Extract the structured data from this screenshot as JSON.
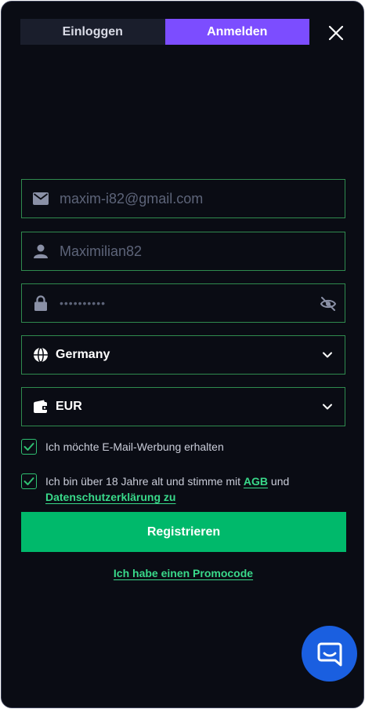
{
  "tabs": [
    {
      "label": "Einloggen",
      "active": false
    },
    {
      "label": "Anmelden",
      "active": true
    }
  ],
  "form": {
    "email": {
      "value": "maxim-i82@gmail.com",
      "icon": "mail-icon"
    },
    "username": {
      "value": "Maximilian82",
      "icon": "user-icon"
    },
    "password": {
      "value": "••••••••••",
      "icon": "lock-icon",
      "toggle_icon": "eye-off-icon"
    },
    "country": {
      "value": "Germany",
      "icon": "globe-icon"
    },
    "currency": {
      "value": "EUR",
      "icon": "wallet-icon"
    }
  },
  "consent": {
    "email_marketing": {
      "checked": true,
      "text": "Ich möchte E-Mail-Werbung erhalten"
    },
    "age_terms": {
      "checked": true,
      "text_before": "Ich bin über 18 Jahre alt und stimme mit ",
      "agb_link": "AGB",
      "text_middle": " und",
      "privacy_link": "Datenschutzerklärung zu"
    }
  },
  "register_button": "Registrieren",
  "promo_link": "Ich habe einen Promocode",
  "colors": {
    "background": "#0a0c14",
    "accent_purple": "#7c4dff",
    "accent_green": "#00b96b",
    "link_green": "#39d98a",
    "chat_blue": "#1a5fe0"
  }
}
